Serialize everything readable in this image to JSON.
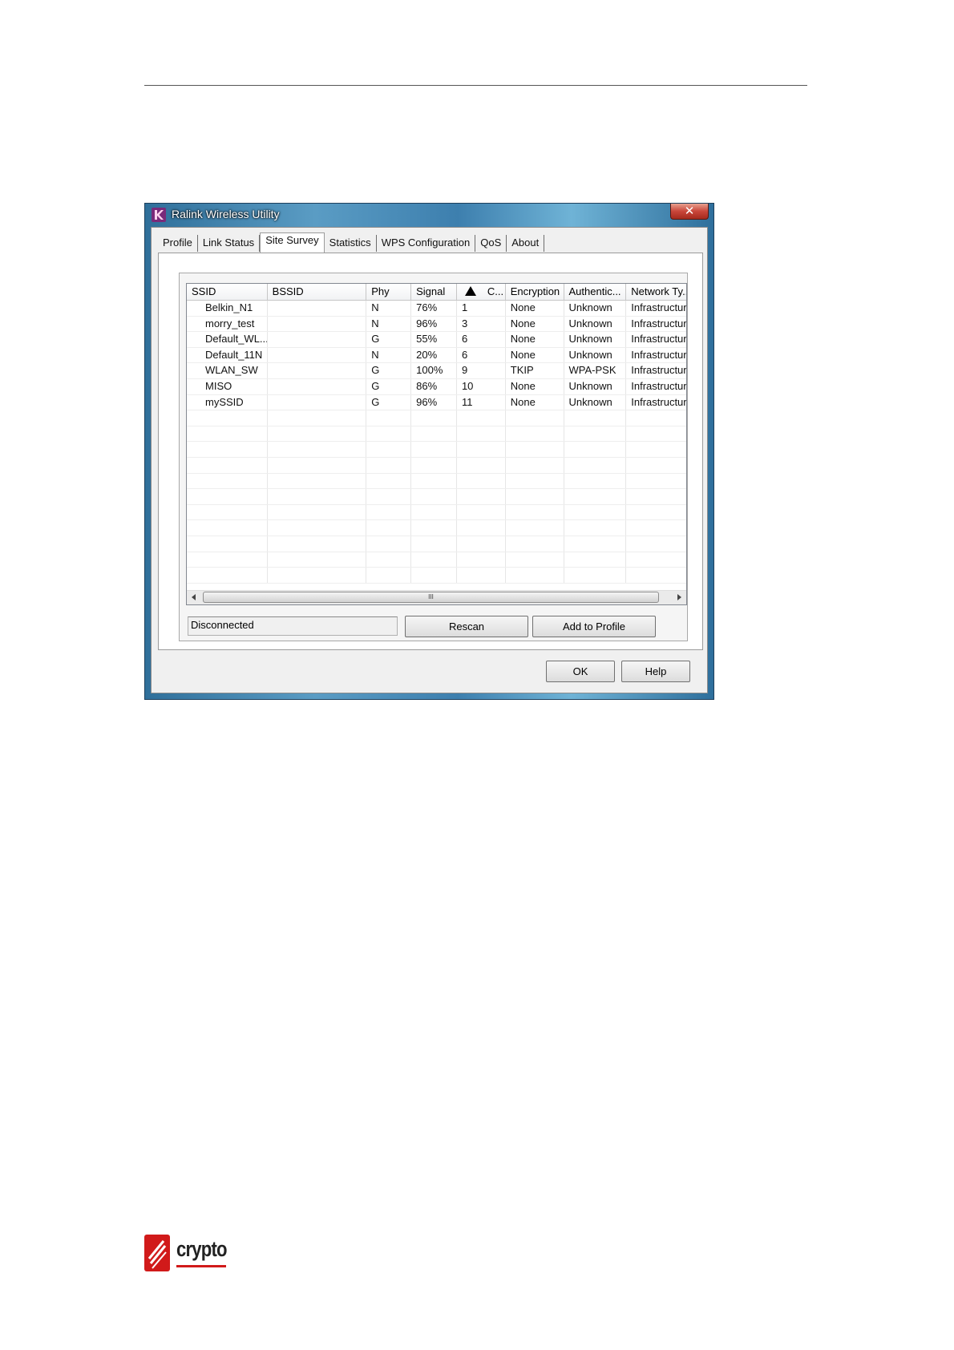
{
  "window": {
    "title": "Ralink Wireless Utility",
    "close_label": "✕"
  },
  "tabs": [
    {
      "label": "Profile"
    },
    {
      "label": "Link Status"
    },
    {
      "label": "Site Survey"
    },
    {
      "label": "Statistics"
    },
    {
      "label": "WPS Configuration"
    },
    {
      "label": "QoS"
    },
    {
      "label": "About"
    }
  ],
  "active_tab": "Site Survey",
  "table": {
    "columns": [
      "SSID",
      "BSSID",
      "Phy",
      "Signal",
      "C...",
      "Encryption",
      "Authentic...",
      "Network Ty..."
    ],
    "sorted_column": "C...",
    "rows": [
      [
        "Belkin_N1",
        "",
        "N",
        "76%",
        "1",
        "None",
        "Unknown",
        "Infrastructure"
      ],
      [
        "morry_test",
        "",
        "N",
        "96%",
        "3",
        "None",
        "Unknown",
        "Infrastructure"
      ],
      [
        "Default_WL...",
        "",
        "G",
        "55%",
        "6",
        "None",
        "Unknown",
        "Infrastructure"
      ],
      [
        "Default_11N",
        "",
        "N",
        "20%",
        "6",
        "None",
        "Unknown",
        "Infrastructure"
      ],
      [
        "WLAN_SW",
        "",
        "G",
        "100%",
        "9",
        "TKIP",
        "WPA-PSK",
        "Infrastructure"
      ],
      [
        "MISO",
        "",
        "G",
        "86%",
        "10",
        "None",
        "Unknown",
        "Infrastructure"
      ],
      [
        "mySSID",
        "",
        "G",
        "96%",
        "11",
        "None",
        "Unknown",
        "Infrastructure"
      ]
    ],
    "scroll_thumb_label": "III"
  },
  "status": "Disconnected",
  "buttons": {
    "rescan": "Rescan",
    "add_to_profile": "Add to Profile",
    "ok": "OK",
    "help": "Help"
  },
  "footer_logo": {
    "text": "crypto",
    "accent_color": "#d11a1a"
  }
}
